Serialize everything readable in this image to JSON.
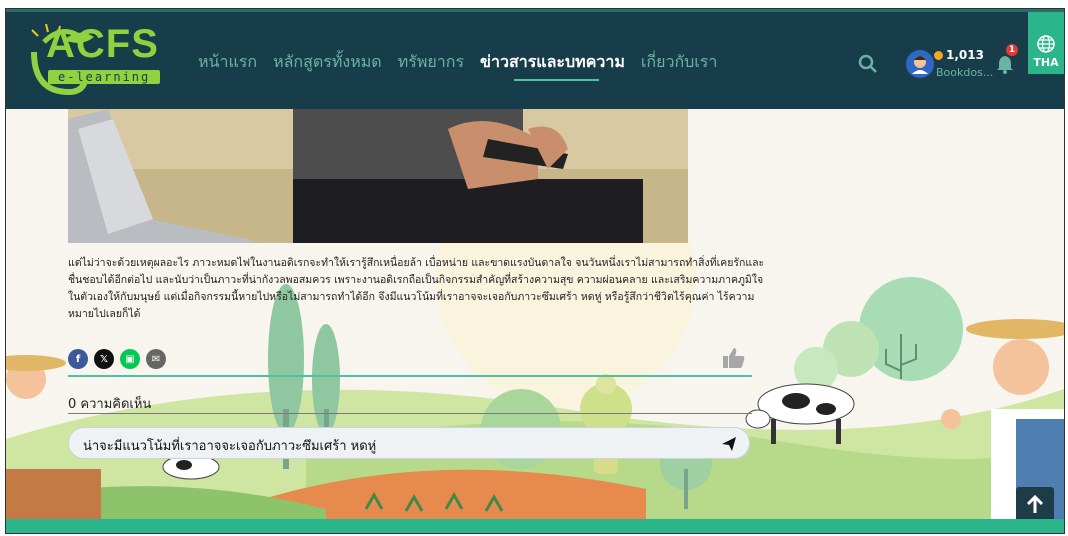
{
  "header": {
    "logo_text": "ACFS",
    "logo_sub": "e-learning",
    "nav": [
      {
        "label": "หน้าแรก",
        "active": false
      },
      {
        "label": "หลักสูตรทั้งหมด",
        "active": false
      },
      {
        "label": "ทรัพยากร",
        "active": false
      },
      {
        "label": "ข่าวสารและบทความ",
        "active": true
      },
      {
        "label": "เกี่ยวกับเรา",
        "active": false
      }
    ],
    "coins": "1,013",
    "user_name": "Bookdos...",
    "notification_count": "1",
    "language": "THA"
  },
  "article": {
    "body": "แต่ไม่ว่าจะด้วยเหตุผลอะไร ภาวะหมดไฟในงานอดิเรกจะทำให้เรารู้สึกเหนื่อยล้า เบื่อหน่าย และขาดแรงบันดาลใจ จนวันหนึ่งเราไม่สามารถทำสิ่งที่เคยรักและชื่นชอบได้อีกต่อไป และนับว่าเป็นภาวะที่น่ากังวลพอสมควร เพราะงานอดิเรกถือเป็นกิจกรรมสำคัญที่สร้างความสุข ความผ่อนคลาย และเสริมความภาคภูมิใจในตัวเองให้กับมนุษย์ แต่เมื่อกิจกรรมนี้หายไปหรือไม่สามารถทำได้อีก จึงมีแนวโน้มที่เราอาจจะเจอกับภาวะซึมเศร้า หดหู่ หรือรู้สึกว่าชีวิตไร้คุณค่า ไร้ความหมายไปเลยก็ได้"
  },
  "share": {
    "buttons": [
      {
        "name": "facebook",
        "glyph": "f",
        "color": "#3b5998"
      },
      {
        "name": "x",
        "glyph": "𝕏",
        "color": "#111111"
      },
      {
        "name": "line",
        "glyph": "▣",
        "color": "#06c755"
      },
      {
        "name": "email",
        "glyph": "✉",
        "color": "#666666"
      }
    ]
  },
  "comments": {
    "count_label": "0 ความคิดเห็น",
    "input_value": "น่าจะมีแนวโน้มที่เราอาจจะเจอกับภาวะซึมเศร้า หดหู่"
  },
  "colors": {
    "header_bg": "#173d4a",
    "accent": "#2bb58a",
    "nav_inactive": "#6ab3a4"
  }
}
